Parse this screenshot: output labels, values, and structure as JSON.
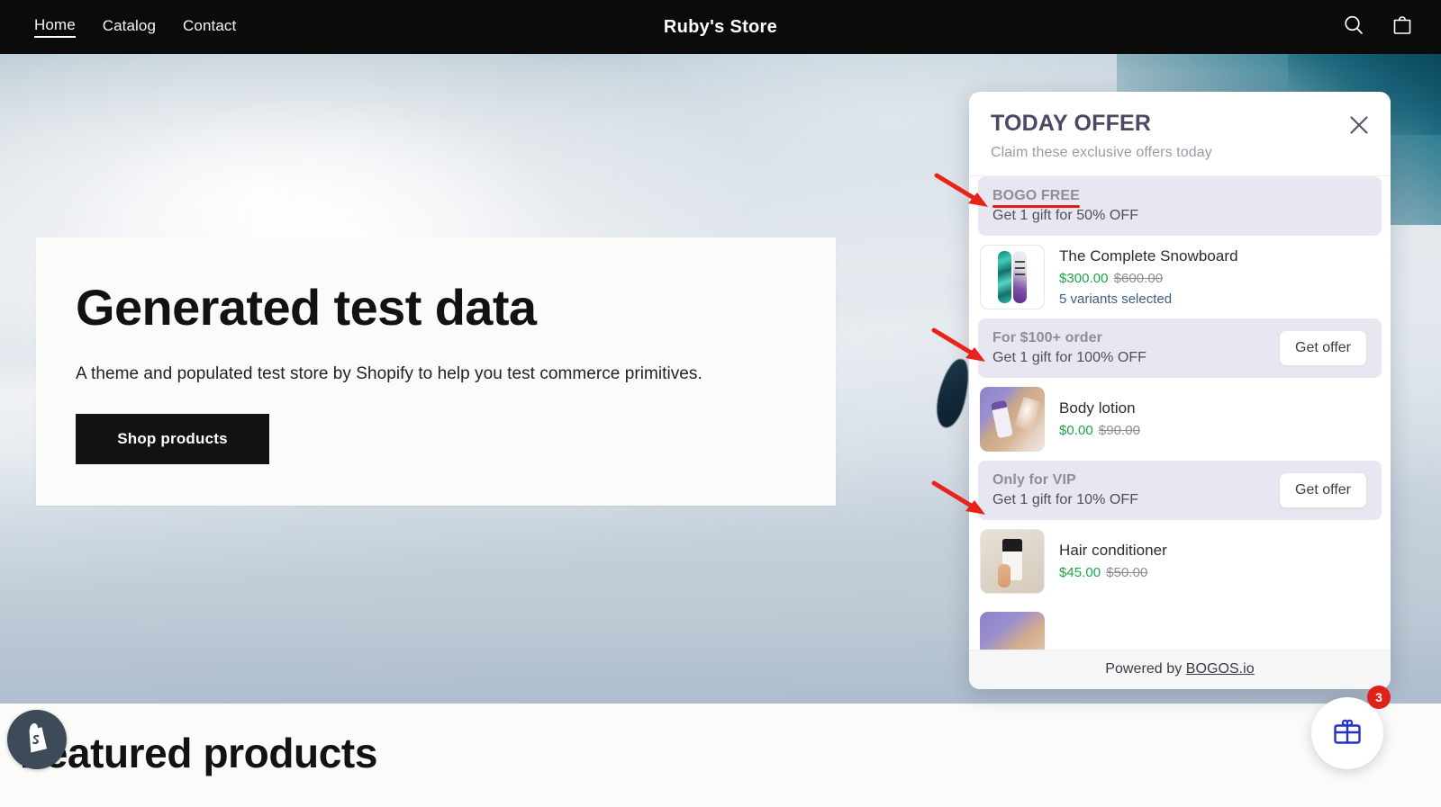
{
  "topnav": {
    "links": [
      {
        "label": "Home",
        "active": true
      },
      {
        "label": "Catalog",
        "active": false
      },
      {
        "label": "Contact",
        "active": false
      }
    ],
    "store_title": "Ruby's Store",
    "search_icon": "search-icon",
    "cart_icon": "shopping-bag-icon"
  },
  "hero": {
    "heading": "Generated test data",
    "subheading": "A theme and populated test store by Shopify to help you test commerce primitives.",
    "cta_label": "Shop products"
  },
  "featured": {
    "heading": "Featured products"
  },
  "shopify_badge": {
    "icon": "shopify-bag-icon"
  },
  "offer_panel": {
    "title": "TODAY OFFER",
    "subtitle": "Claim these exclusive offers today",
    "close_icon": "close-icon",
    "footer_prefix": "Powered by ",
    "footer_link": "BOGOS.io",
    "colors": {
      "offer_row_bg": "#e8e7f1",
      "price_new": "#1ea34a",
      "price_old": "#8d8d96",
      "variant_note": "#3c5d86",
      "title": "#4a4a66",
      "annotation_red": "#e01b10"
    },
    "items": [
      {
        "kind": "offer",
        "name": "BOGO FREE",
        "description": "Get 1 gift for 50% OFF",
        "has_button": false,
        "annotated": true
      },
      {
        "kind": "product",
        "title": "The Complete Snowboard",
        "price_new": "$300.00",
        "price_old": "$600.00",
        "variant_note": "5 variants selected",
        "thumb": "snowboard-thumbnail"
      },
      {
        "kind": "offer",
        "name": "For $100+ order",
        "description": "Get 1 gift for 100% OFF",
        "has_button": true,
        "button_label": "Get offer",
        "annotated": false
      },
      {
        "kind": "product",
        "title": "Body lotion",
        "price_new": "$0.00",
        "price_old": "$90.00",
        "variant_note": "",
        "thumb": "body-lotion-thumbnail"
      },
      {
        "kind": "offer",
        "name": "Only for VIP",
        "description": "Get 1 gift for 10% OFF",
        "has_button": true,
        "button_label": "Get offer",
        "annotated": false
      },
      {
        "kind": "product",
        "title": "Hair conditioner",
        "price_new": "$45.00",
        "price_old": "$50.00",
        "variant_note": "",
        "thumb": "hair-conditioner-thumbnail"
      }
    ]
  },
  "gift_launcher": {
    "icon": "gift-icon",
    "badge_count": "3"
  }
}
